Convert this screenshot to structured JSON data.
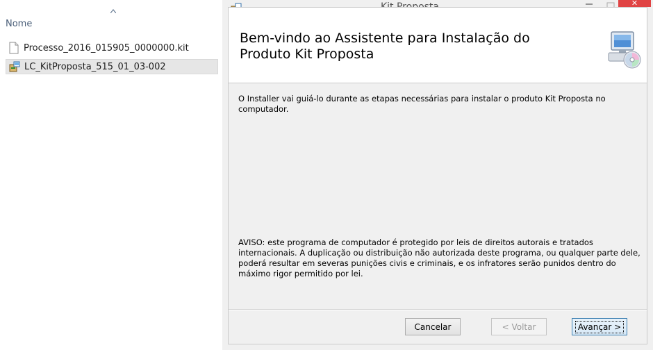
{
  "explorer": {
    "column_header": "Nome",
    "files": [
      {
        "name": "Processo_2016_015905_0000000.kit",
        "icon": "document-icon",
        "selected": false
      },
      {
        "name": "LC_KitProposta_515_01_03-002",
        "icon": "installer-package-icon",
        "selected": true
      }
    ]
  },
  "window": {
    "title": "Kit Proposta",
    "banner_title": "Bem-vindo ao Assistente para Instalação do Produto Kit Proposta",
    "intro_text": "O Installer vai guiá-lo durante as etapas necessárias para instalar o produto Kit Proposta no computador.",
    "warning_text": "AVISO: este programa de computador é protegido por leis de direitos autorais e tratados internacionais. A duplicação ou distribuição não autorizada deste programa, ou qualquer parte dele, poderá resultar em severas punições civis e criminais, e os infratores serão punidos dentro do máximo rigor permitido por lei.",
    "buttons": {
      "cancel": "Cancelar",
      "back": "< Voltar",
      "next": "Avançar >"
    }
  },
  "colors": {
    "close_button": "#e04343",
    "header_text": "#4c607a",
    "selection": "#e6e6e6"
  }
}
